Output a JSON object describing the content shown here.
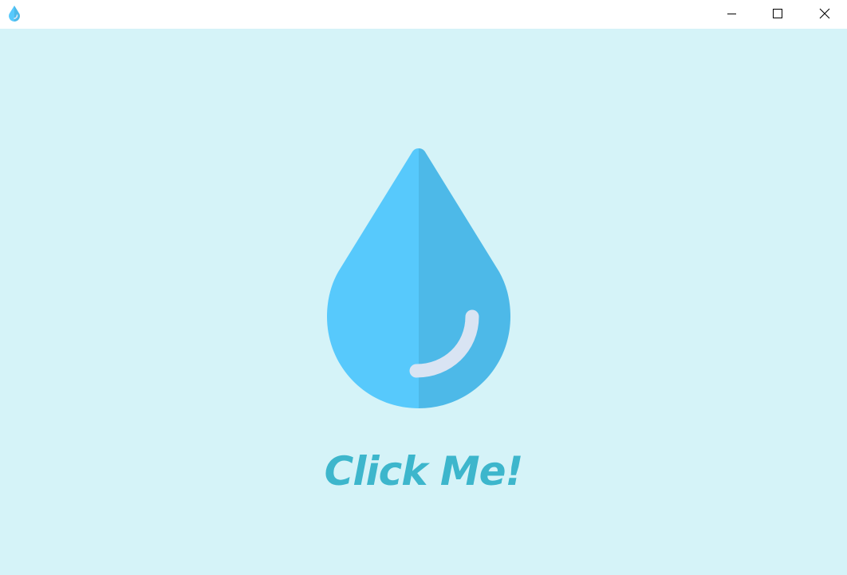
{
  "window": {
    "app_icon": "water-drop-icon",
    "controls": {
      "minimize_icon": "minimize-icon",
      "maximize_icon": "maximize-icon",
      "close_icon": "close-icon"
    }
  },
  "main": {
    "drop_icon": "water-drop-icon",
    "button_label": "Click Me!"
  },
  "colors": {
    "background": "#d5f3f8",
    "titlebar": "#ffffff",
    "drop_light": "#57c9fc",
    "drop_dark": "#4db9e8",
    "highlight": "#d9e4f3",
    "label": "#3db6cc"
  }
}
